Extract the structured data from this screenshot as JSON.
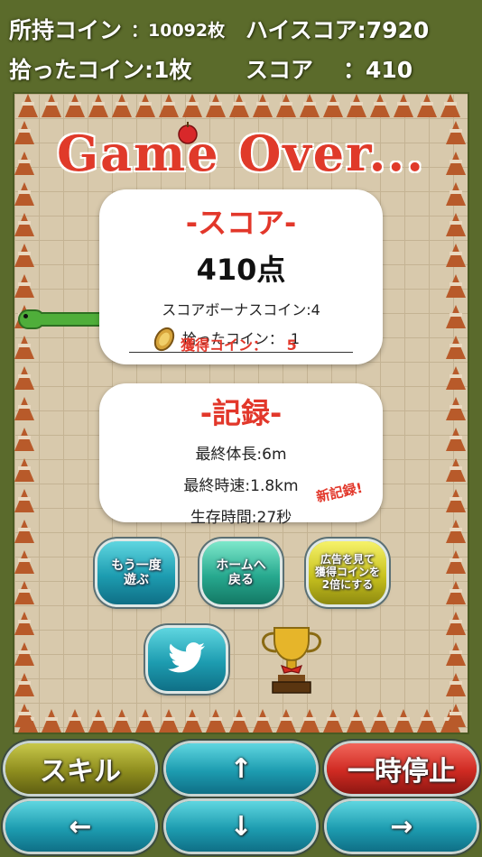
{
  "hud": {
    "owned_coins_label": "所持コイン",
    "owned_coins_value": "：10092枚",
    "high_score": "ハイスコア:7920",
    "picked_coins": "拾ったコイン:1枚",
    "score_label": "スコア",
    "score_value": "：410"
  },
  "title": "Game Over...",
  "score_card": {
    "heading": "-スコア-",
    "points": "410点",
    "bonus": "スコアボーナスコイン:4",
    "picked": "拾ったコイン：　1",
    "earned_label": "獲得コイン：",
    "earned_value": "5"
  },
  "record_card": {
    "heading": "-記録-",
    "length": "最終体長:6m",
    "speed": "最終時速:1.8km",
    "time": "生存時間:27秒",
    "new_record": "新記録!"
  },
  "buttons": {
    "retry": "もう一度\n遊ぶ",
    "home": "ホームへ\n戻る",
    "ad_double": "広告を見て\n獲得コインを\n2倍にする"
  },
  "controls": {
    "skill": "スキル",
    "up": "↑",
    "pause": "一時停止",
    "left": "←",
    "down": "↓",
    "right": "→"
  },
  "colors": {
    "accent_red": "#e2372a",
    "hud_green": "#5b6b2b"
  }
}
